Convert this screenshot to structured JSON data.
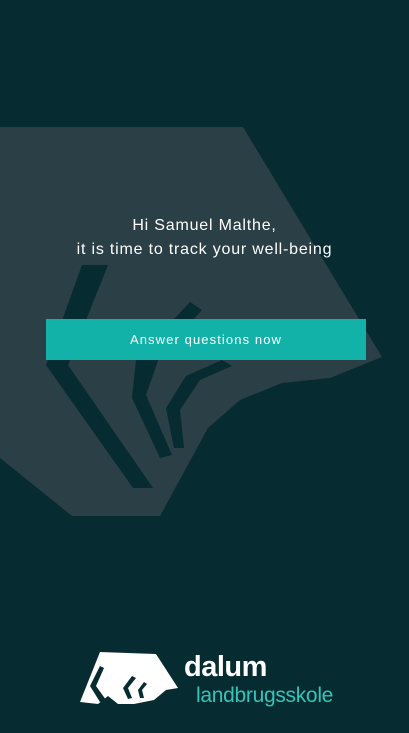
{
  "greeting": {
    "line1": "Hi Samuel Malthe,",
    "line2": "it is time to track your well-being"
  },
  "cta": {
    "label": "Answer questions now"
  },
  "logo": {
    "word1": "dalum",
    "word2": "landbrugsskole",
    "icon": "bull-icon"
  },
  "colors": {
    "background": "#062b31",
    "accent": "#12b2a8",
    "logo_accent": "#34c4b9"
  }
}
